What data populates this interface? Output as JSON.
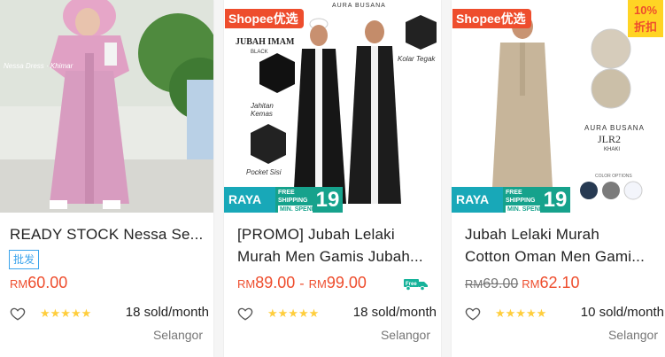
{
  "colors": {
    "accent": "#ee4d2d",
    "wholesale": "#3ba4ec",
    "stars": "#ffce3d",
    "promo": "#16a28c"
  },
  "products": [
    {
      "title": "READY STOCK Nessa Se...",
      "title_lines": [],
      "badge": "",
      "discount": "",
      "tag": "批发",
      "image_text": {
        "caption": "Nessa Dress · Khimar"
      },
      "price_original": "",
      "price": "60.00",
      "price_max": "",
      "currency": "RM",
      "free_shipping": false,
      "rating": 5,
      "sold": "18 sold/month",
      "location": "Selangor",
      "promo": null
    },
    {
      "title": "",
      "title_lines": [
        "[PROMO] Jubah Lelaki",
        "Murah Men Gamis Jubah..."
      ],
      "badge": "Shopee优选",
      "discount": "",
      "tag": "",
      "image_text": {
        "brand": "AURA BUSANA",
        "heading": "JUBAH IMAM",
        "sub": "BLACK",
        "note1": "Jahitan Kemas",
        "note2": "Pocket Sisi",
        "note3": "Kolar Tegak"
      },
      "price_original": "",
      "price": "89.00",
      "price_max": "99.00",
      "currency": "RM",
      "free_shipping": true,
      "rating": 5,
      "sold": "18 sold/month",
      "location": "Selangor",
      "promo": {
        "brand": "RAYA",
        "line1": "FREE",
        "line2": "SHIPPING",
        "line3": "MIN. SPEND",
        "amount": "19"
      }
    },
    {
      "title": "",
      "title_lines": [
        "Jubah Lelaki Murah",
        "Cotton Oman Men Gami..."
      ],
      "badge": "Shopee优选",
      "discount_pct": "10%",
      "discount_label": "折扣",
      "tag": "",
      "image_text": {
        "brand": "AURA BUSANA",
        "model": "JLR2",
        "sub": "KHAKI",
        "colors_label": "COLOR OPTIONS"
      },
      "price_original": "69.00",
      "price": "62.10",
      "price_max": "",
      "currency": "RM",
      "free_shipping": false,
      "rating": 5,
      "sold": "10 sold/month",
      "location": "Selangor",
      "promo": {
        "brand": "RAYA",
        "line1": "FREE",
        "line2": "SHIPPING",
        "line3": "MIN. SPEND",
        "amount": "19"
      }
    }
  ],
  "icons": {
    "favorite": "heart-outline-icon",
    "free_shipping": "truck-icon",
    "star": "star-icon"
  }
}
